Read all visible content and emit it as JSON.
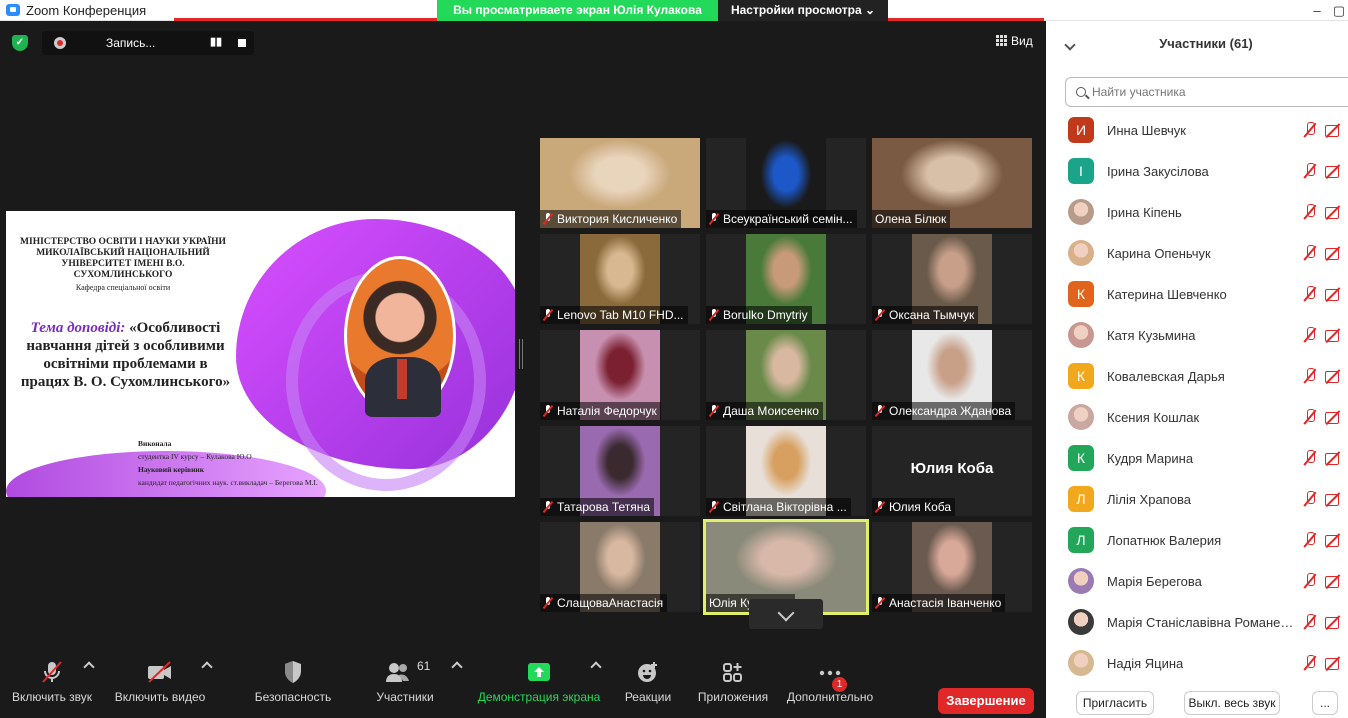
{
  "window": {
    "title": "Zoom Конференция"
  },
  "share_banner": "Вы просматриваете экран Юлія Кулакова",
  "view_settings": "Настройки просмотра",
  "recording": {
    "label": "Запись..."
  },
  "view_button": "Вид",
  "slide": {
    "header": "МІНІСТЕРСТВО ОСВІТИ І НАУКИ УКРАЇНИ МИКОЛАЇВСЬКИЙ НАЦІОНАЛЬНИЙ УНІВЕРСИТЕТ ІМЕНІ В.О. СУХОМЛИНСЬКОГО",
    "department": "Кафедра спеціальної освіти",
    "topic_label": "Тема доповіді:",
    "topic": "«Особливості навчання дітей з особливими освітніми проблемами в працях В. О. Сухомлинського»",
    "by_label": "Виконала",
    "by_value": "студентка IV курсу – Кулакова Ю.О",
    "advisor_label": "Науковий керівник",
    "advisor_value": "кандидат педагогічних наук. ст.викладач – Берегова М.І."
  },
  "gallery": [
    {
      "name": "Виктория Кисличенко",
      "muted": true,
      "bg": "#c9a87a",
      "fg": "#e9d4bc"
    },
    {
      "name": "Всеукраїнський семін...",
      "muted": true,
      "bg": "#1a1a1a",
      "fg": "#1c58c8"
    },
    {
      "name": "Олена Білюк",
      "muted": false,
      "bg": "#7a5a42",
      "fg": "#d8c0a8"
    },
    {
      "name": "Lenovo Tab M10 FHD...",
      "muted": true,
      "bg": "#8a6a3a",
      "fg": "#d8b890"
    },
    {
      "name": "Borulko Dmytriy",
      "muted": true,
      "bg": "#4a7a3a",
      "fg": "#c89a7a"
    },
    {
      "name": "Оксана Тымчук",
      "muted": true,
      "bg": "#6a5a4a",
      "fg": "#c8a08a"
    },
    {
      "name": "Наталія Федорчук",
      "muted": true,
      "bg": "#c890b0",
      "fg": "#7a2030"
    },
    {
      "name": "Даша Моисеенко",
      "muted": true,
      "bg": "#6a8a4a",
      "fg": "#d8b8a0"
    },
    {
      "name": "Олександра Жданова",
      "muted": true,
      "bg": "#e8e8e8",
      "fg": "#c8a088"
    },
    {
      "name": "Татарова Тетяна",
      "muted": true,
      "bg": "#9a6ab0",
      "fg": "#3a2a30"
    },
    {
      "name": "Світлана Вікторівна ...",
      "muted": true,
      "bg": "#e8e0d8",
      "fg": "#d8a060"
    },
    {
      "name": "Юлия Коба",
      "muted": true,
      "bg": "#242424",
      "fg": "#242424",
      "big": "Юлия Коба"
    },
    {
      "name": "СлащоваАнастасія",
      "muted": true,
      "bg": "#8a7a6a",
      "fg": "#d8b8a0"
    },
    {
      "name": "Юлія Кулакова",
      "muted": false,
      "bg": "#8a8a7a",
      "fg": "#d8b8a8",
      "active": true
    },
    {
      "name": "Анастасія Іванченко",
      "muted": true,
      "bg": "#6a5a50",
      "fg": "#d8a898"
    }
  ],
  "toolbar": {
    "mic": "Включить звук",
    "video": "Включить видео",
    "security": "Безопасность",
    "participants": "Участники",
    "participants_count": "61",
    "share": "Демонстрация экрана",
    "reactions": "Реакции",
    "apps": "Приложения",
    "more": "Дополнительно",
    "more_badge": "1",
    "end": "Завершение"
  },
  "panel": {
    "title": "Участники (61)",
    "search_placeholder": "Найти участника",
    "invite": "Пригласить",
    "mute_all": "Выкл. весь звук",
    "more": "...",
    "participants": [
      {
        "name": "Инна Шевчук",
        "initial": "И",
        "color": "#c0391b"
      },
      {
        "name": "Ірина Закусілова",
        "initial": "І",
        "color": "#1aa58a"
      },
      {
        "name": "Ірина Кіпень",
        "initial": "",
        "color": "#b89a8a"
      },
      {
        "name": "Карина Опеньчук",
        "initial": "",
        "color": "#d8b08a"
      },
      {
        "name": "Катерина Шевченко",
        "initial": "К",
        "color": "#e0641c"
      },
      {
        "name": "Катя Кузьмина",
        "initial": "",
        "color": "#c89890"
      },
      {
        "name": "Ковалевская Дарья",
        "initial": "К",
        "color": "#f2a81c"
      },
      {
        "name": "Ксения Кошлак",
        "initial": "",
        "color": "#c8a8a0"
      },
      {
        "name": "Кудря Марина",
        "initial": "К",
        "color": "#21a65a"
      },
      {
        "name": "Лілія Храпова",
        "initial": "Л",
        "color": "#f2a81c"
      },
      {
        "name": "Лопатнюк Валерия",
        "initial": "Л",
        "color": "#21a65a"
      },
      {
        "name": "Марія Берегова",
        "initial": "",
        "color": "#9a7ab0"
      },
      {
        "name": "Марія Станіславівна Романен...",
        "initial": "",
        "color": "#3a3a3a"
      },
      {
        "name": "Надія Яцина",
        "initial": "",
        "color": "#d8b890"
      }
    ]
  },
  "colors": {
    "accent_green": "#23d959",
    "end_red": "#e02828",
    "panel_bg": "#ffffff"
  }
}
